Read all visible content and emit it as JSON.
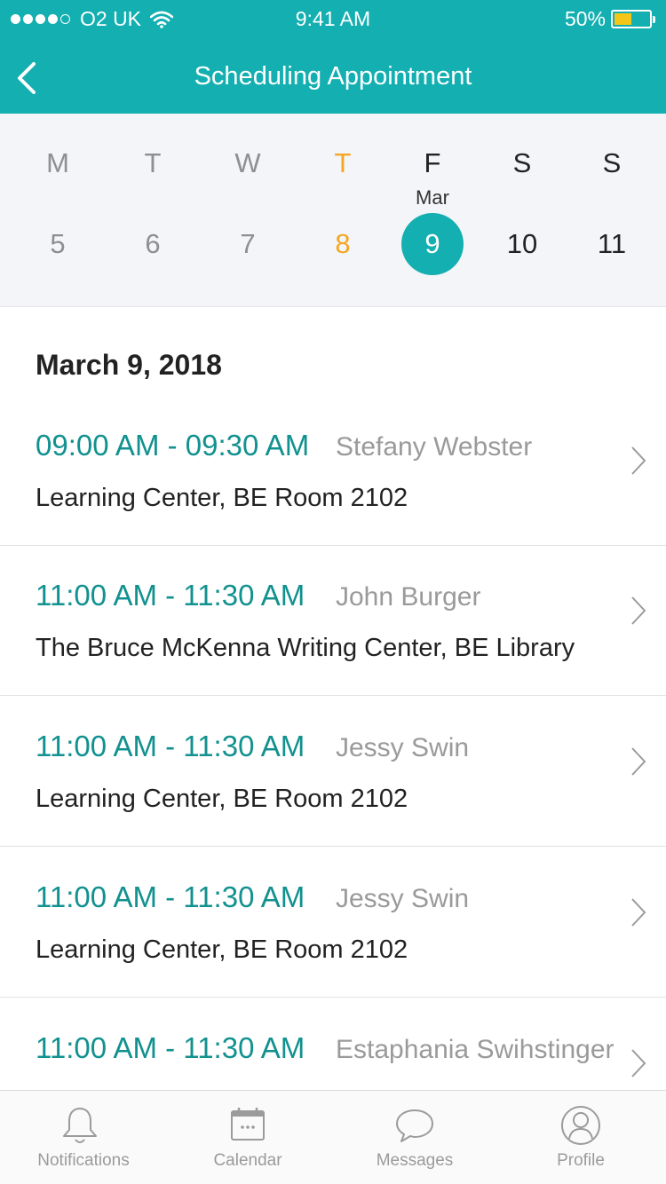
{
  "status_bar": {
    "carrier": "O2 UK",
    "time": "9:41 AM",
    "battery": "50%",
    "battery_level": 0.5,
    "signal_bars_filled": 4,
    "signal_bars_total": 5
  },
  "header": {
    "title": "Scheduling Appointment",
    "back_icon": "chevron-left-icon"
  },
  "week": {
    "month_label": "Mar",
    "days": [
      {
        "letter": "M",
        "number": "5",
        "state": "past"
      },
      {
        "letter": "T",
        "number": "6",
        "state": "past"
      },
      {
        "letter": "W",
        "number": "7",
        "state": "past"
      },
      {
        "letter": "T",
        "number": "8",
        "state": "today"
      },
      {
        "letter": "F",
        "number": "9",
        "state": "selected"
      },
      {
        "letter": "S",
        "number": "10",
        "state": "future"
      },
      {
        "letter": "S",
        "number": "11",
        "state": "future"
      }
    ]
  },
  "schedule": {
    "date_heading": "March 9, 2018",
    "appointments": [
      {
        "time": "09:00 AM - 09:30 AM",
        "name": "Stefany Webster",
        "location": "Learning Center, BE Room 2102"
      },
      {
        "time": "11:00 AM - 11:30 AM",
        "name": "John Burger",
        "location": "The Bruce McKenna Writing Center, BE Library"
      },
      {
        "time": "11:00 AM - 11:30 AM",
        "name": "Jessy Swin",
        "location": "Learning Center, BE Room 2102"
      },
      {
        "time": "11:00 AM - 11:30 AM",
        "name": "Jessy Swin",
        "location": "Learning Center, BE Room 2102"
      },
      {
        "time": "11:00 AM - 11:30 AM",
        "name": "Estaphania Swihstinger",
        "location": ""
      }
    ]
  },
  "tabbar": {
    "tabs": [
      {
        "label": "Notifications",
        "icon": "bell-icon"
      },
      {
        "label": "Calendar",
        "icon": "calendar-icon"
      },
      {
        "label": "Messages",
        "icon": "chat-bubble-icon"
      },
      {
        "label": "Profile",
        "icon": "profile-icon"
      }
    ]
  },
  "colors": {
    "accent": "#14afb1",
    "time_text": "#11918f",
    "today": "#f5a623",
    "battery_fill": "#f5c518"
  }
}
